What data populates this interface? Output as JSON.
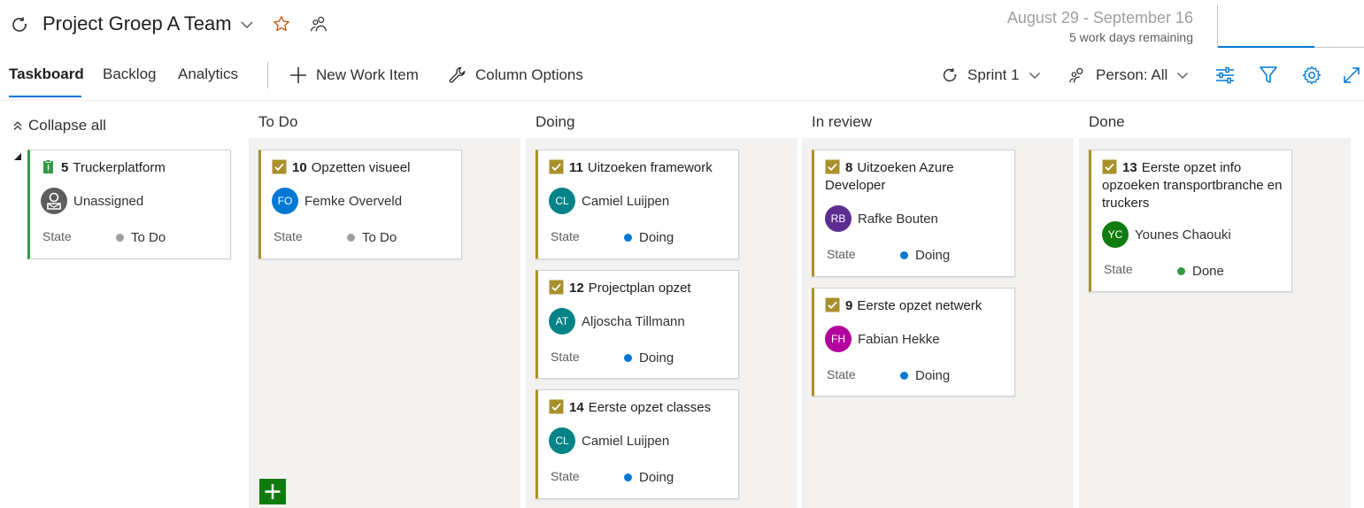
{
  "header": {
    "team_name": "Project Groep A Team",
    "sprint_dates": "August 29 - September 16",
    "work_days_remaining": "5 work days remaining",
    "sprint_progress_fraction": 0.66
  },
  "toolbar": {
    "tabs": [
      {
        "label": "Taskboard",
        "active": true
      },
      {
        "label": "Backlog",
        "active": false
      },
      {
        "label": "Analytics",
        "active": false
      }
    ],
    "new_work_item": "New Work Item",
    "column_options": "Column Options",
    "sprint_selector": "Sprint 1",
    "person_filter": "Person: All",
    "icons": [
      "settings-sliders-icon",
      "filter-icon",
      "gear-icon",
      "fullscreen-icon"
    ]
  },
  "board": {
    "collapse_all": "Collapse all",
    "columns": [
      "To Do",
      "Doing",
      "In review",
      "Done"
    ],
    "state_label": "State",
    "parent": {
      "id": "5",
      "title": "Truckerplatform",
      "assignee": "Unassigned",
      "state": "To Do"
    },
    "todo": [
      {
        "id": "10",
        "title": "Opzetten visueel",
        "initials": "FO",
        "assignee": "Femke Overveld",
        "state": "To Do"
      }
    ],
    "doing": [
      {
        "id": "11",
        "title": "Uitzoeken framework",
        "initials": "CL",
        "assignee": "Camiel Luijpen",
        "state": "Doing"
      },
      {
        "id": "12",
        "title": "Projectplan opzet",
        "initials": "AT",
        "assignee": "Aljoscha Tillmann",
        "state": "Doing"
      },
      {
        "id": "14",
        "title": "Eerste opzet classes",
        "initials": "CL",
        "assignee": "Camiel Luijpen",
        "state": "Doing"
      }
    ],
    "in_review": [
      {
        "id": "8",
        "title": "Uitzoeken Azure Developer",
        "initials": "RB",
        "assignee": "Rafke Bouten",
        "state": "Doing"
      },
      {
        "id": "9",
        "title": "Eerste opzet netwerk",
        "initials": "FH",
        "assignee": "Fabian Hekke",
        "state": "Doing"
      }
    ],
    "done": [
      {
        "id": "13",
        "title": "Eerste opzet info opzoeken transportbranche en truckers",
        "initials": "YC",
        "assignee": "Younes Chaouki",
        "state": "Done"
      }
    ]
  },
  "colors": {
    "accent": "#0078d4",
    "task_bar": "#a8912d",
    "pbi_bar": "#339947",
    "state_todo": "#a19f9d",
    "state_doing": "#0078d4",
    "state_done": "#339947",
    "avatar_fo": "#0078d4",
    "avatar_cl": "#038387",
    "avatar_at": "#038387",
    "avatar_rb": "#5c2e91",
    "avatar_fh": "#b4009e",
    "avatar_yc": "#107c10"
  }
}
